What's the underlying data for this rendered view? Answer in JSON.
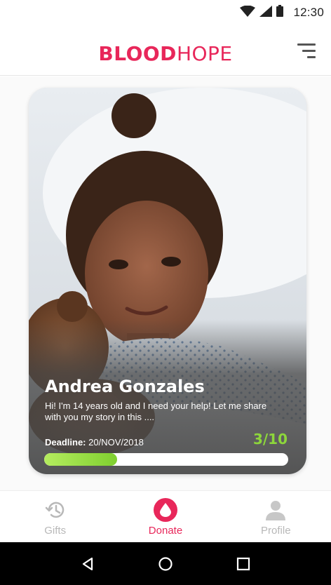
{
  "status_bar": {
    "time": "12:30"
  },
  "header": {
    "logo_bold": "BLOOD",
    "logo_light": "HOPE"
  },
  "card": {
    "name": "Andrea Gonzales",
    "story": "Hi! I'm 14 years old and I need your help! Let me share with you my story in this ....",
    "deadline_label": "Deadline:",
    "deadline_value": "20/NOV/2018",
    "progress_text": "3/10",
    "progress_fraction": 0.3
  },
  "bottom_nav": {
    "items": [
      {
        "label": "Gifts",
        "icon": "history-icon",
        "active": false
      },
      {
        "label": "Donate",
        "icon": "blood-drop-icon",
        "active": true
      },
      {
        "label": "Profile",
        "icon": "person-icon",
        "active": false
      }
    ]
  },
  "colors": {
    "brand": "#e8275a",
    "progress": "#8dd63b",
    "inactive": "#b8b8b8"
  }
}
